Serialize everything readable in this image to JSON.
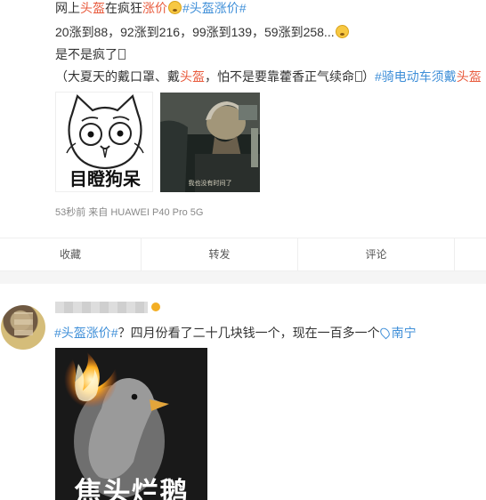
{
  "post1": {
    "line1": {
      "t1": "网上",
      "t2": "头盔",
      "t3": "在疯狂",
      "t4": "涨价",
      "emoji": "fearful-emoji",
      "tag": "#头盔涨价#"
    },
    "line2": {
      "t1": "20涨到88，92涨到216，99涨到139，59涨到258...",
      "emoji": "fearful-emoji"
    },
    "line3": {
      "t1": "是不是疯了"
    },
    "line4": {
      "t1": "（大夏天的戴口罩、戴",
      "t2": "头盔",
      "t3": "，怕不是要靠藿香正气续命",
      "t4": "）",
      "tag": "#骑电动车须戴",
      "tag2": "头盔"
    },
    "image1": {
      "caption": "目瞪狗呆"
    },
    "image2": {
      "subtitle": "我也没有时间了"
    },
    "meta": "53秒前  来自 HUAWEI P40 Pro 5G",
    "actions": [
      "收藏",
      "转发",
      "评论"
    ]
  },
  "post2": {
    "line": {
      "tag": "#头盔涨价#",
      "text": "？四月份看了二十几块钱一个，现在一百多一个",
      "location": "南宁"
    },
    "image": {
      "title": "焦头烂鹅"
    }
  },
  "colors": {
    "keyword": "#e85a3c",
    "link": "#3f8fd8",
    "background": "#ffffff",
    "separator": "#f5f5f5",
    "meta": "#888888"
  },
  "icons": [
    "fearful-emoji",
    "location-pin-icon",
    "verified-badge-icon"
  ]
}
